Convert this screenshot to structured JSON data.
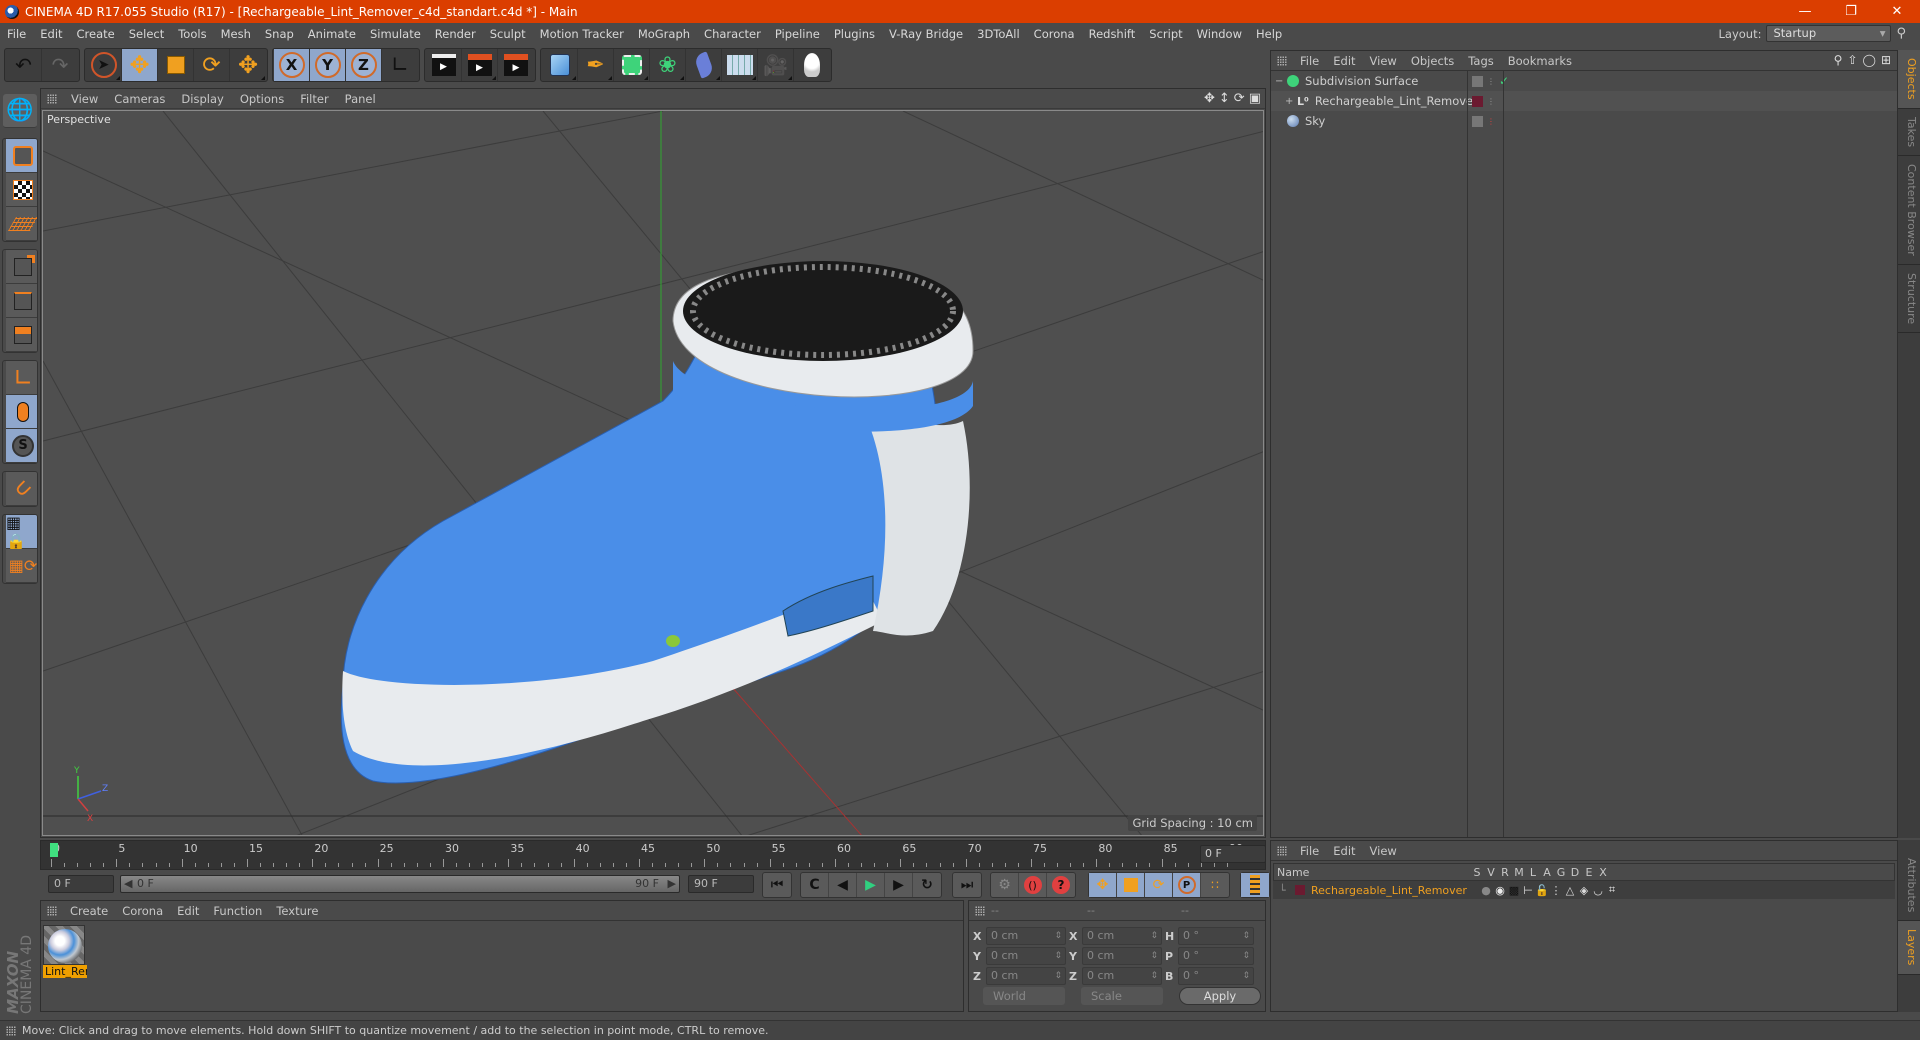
{
  "window": {
    "title": "CINEMA 4D R17.055 Studio (R17) - [Rechargeable_Lint_Remover_c4d_standart.c4d *] - Main",
    "controls": [
      "minimize",
      "restore",
      "close"
    ]
  },
  "menubar": [
    "File",
    "Edit",
    "Create",
    "Select",
    "Tools",
    "Mesh",
    "Snap",
    "Animate",
    "Simulate",
    "Render",
    "Sculpt",
    "Motion Tracker",
    "MoGraph",
    "Character",
    "Pipeline",
    "Plugins",
    "V-Ray Bridge",
    "3DToAll",
    "Corona",
    "Redshift",
    "Script",
    "Window",
    "Help"
  ],
  "layout": {
    "label": "Layout:",
    "value": "Startup"
  },
  "toolbar": {
    "undo": "undo-icon",
    "redo": "redo-icon",
    "tools": [
      "live-selection",
      "move",
      "scale",
      "rotate",
      "recent-tool"
    ],
    "axes": [
      "X",
      "Y",
      "Z"
    ],
    "coord_system": "world-coordinate",
    "render": [
      "render-view",
      "render-picture-viewer",
      "edit-render-settings"
    ],
    "objects": [
      "cube",
      "pen",
      "subdivision-surface",
      "array",
      "bend",
      "floor",
      "camera",
      "light"
    ]
  },
  "left_tools": [
    "model-mode",
    "texture-mode",
    "workplane",
    "points-mode",
    "edges-mode",
    "polygons-mode",
    "axis-mode",
    "tweak",
    "solo",
    "snap",
    "locked-workplane",
    "workplane-align"
  ],
  "viewport": {
    "menu": [
      "View",
      "Cameras",
      "Display",
      "Options",
      "Filter",
      "Panel"
    ],
    "camera_label": "Perspective",
    "grid_spacing": "Grid Spacing : 10 cm",
    "axis": {
      "x": "X",
      "y": "Y",
      "z": "Z"
    }
  },
  "object_manager": {
    "menu": [
      "File",
      "Edit",
      "View",
      "Objects",
      "Tags",
      "Bookmarks"
    ],
    "objects": [
      {
        "name": "Subdivision Surface",
        "icon": "subdivision-surface-icon",
        "expand": "−",
        "check": "✓"
      },
      {
        "name": "Rechargeable_Lint_Remover",
        "icon": "null-object-icon",
        "expand": "+",
        "color": "#6b1a30"
      },
      {
        "name": "Sky",
        "icon": "sky-icon",
        "expand": ""
      }
    ]
  },
  "side_tabs_top": [
    {
      "label": "Objects",
      "active": true
    },
    {
      "label": "Takes",
      "active": false
    },
    {
      "label": "Content Browser",
      "active": false
    },
    {
      "label": "Structure",
      "active": false
    }
  ],
  "side_tabs_bottom": [
    {
      "label": "Attributes",
      "active": false
    },
    {
      "label": "Layers",
      "active": true
    }
  ],
  "timeline": {
    "ticks": [
      "0",
      "5",
      "10",
      "15",
      "20",
      "25",
      "30",
      "35",
      "40",
      "45",
      "50",
      "55",
      "60",
      "65",
      "70",
      "75",
      "80",
      "85",
      "90"
    ],
    "current_frame": "0 F",
    "start_field": "0 F",
    "range_start": "0 F",
    "range_end": "90 F",
    "end_field": "90 F"
  },
  "material_manager": {
    "menu": [
      "Create",
      "Corona",
      "Edit",
      "Function",
      "Texture"
    ],
    "materials": [
      {
        "name": "Lint_Rer"
      }
    ]
  },
  "coordinates": {
    "headers": [
      "--",
      "--",
      "--"
    ],
    "rows": [
      {
        "l1": "X",
        "v1": "0 cm",
        "l2": "X",
        "v2": "0 cm",
        "l3": "H",
        "v3": "0 °"
      },
      {
        "l1": "Y",
        "v1": "0 cm",
        "l2": "Y",
        "v2": "0 cm",
        "l3": "P",
        "v3": "0 °"
      },
      {
        "l1": "Z",
        "v1": "0 cm",
        "l2": "Z",
        "v2": "0 cm",
        "l3": "B",
        "v3": "0 °"
      }
    ],
    "space": "World",
    "mode": "Scale",
    "apply": "Apply"
  },
  "layer_manager": {
    "menu": [
      "File",
      "Edit",
      "View"
    ],
    "columns": [
      "Name",
      "S",
      "V",
      "R",
      "M",
      "L",
      "A",
      "G",
      "D",
      "E",
      "X"
    ],
    "layers": [
      {
        "name": "Rechargeable_Lint_Remover",
        "color": "#6b1a30"
      }
    ]
  },
  "brand": {
    "maxon": "MAXON",
    "product": "CINEMA 4D"
  },
  "status": "Move: Click and drag to move elements. Hold down SHIFT to quantize movement / add to the selection in point mode, CTRL to remove.",
  "colors": {
    "titlebar": "#db3e00",
    "accent": "#f0a020",
    "active_button": "#8fa7cc"
  }
}
